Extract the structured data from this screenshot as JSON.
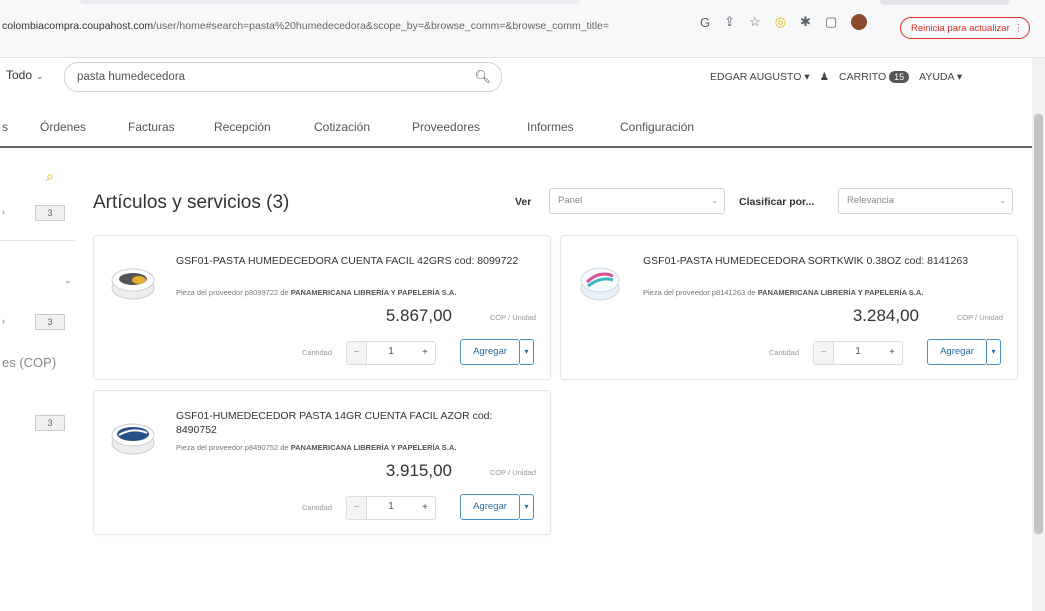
{
  "browser": {
    "url_host": "colombiacompra.coupahost.com",
    "url_rest": "/user/home#search=pasta%20humedecedora&scope_by=&browse_comm=&browse_comm_title=",
    "refresh_button": "Reinicia para actualizar",
    "icons": [
      "google-icon",
      "share-icon",
      "star-icon",
      "extension-icon",
      "puzzle-icon",
      "sidebar-icon",
      "profile-avatar",
      "kebab-menu-icon"
    ]
  },
  "header": {
    "scope": "Todo",
    "search_value": "pasta humedecedora",
    "user": "EDGAR AUGUSTO",
    "cart_label": "CARRITO",
    "cart_count": "15",
    "help_label": "AYUDA"
  },
  "nav": {
    "items": [
      "s",
      "Órdenes",
      "Facturas",
      "Recepción",
      "Cotización",
      "Proveedores",
      "Informes",
      "Configuración"
    ]
  },
  "sidebar": {
    "counts": [
      "3",
      "3",
      "3"
    ],
    "partial_label": "es (COP)"
  },
  "results": {
    "title": "Artículos y servicios (3)",
    "view_label": "Ver",
    "view_value": "Panel",
    "sort_label": "Clasificar por...",
    "sort_value": "Relevancia"
  },
  "products": [
    {
      "name": "GSF01-PASTA HUMEDECEDORA CUENTA FACIL 42GRS cod: 8099722",
      "supplier_prefix": "Pieza del proveedor p8099722 de",
      "supplier": "PANAMERICANA LIBRERÍA Y PAPELERÍA S.A.",
      "price": "5.867,00",
      "unit": "COP / Unidad",
      "qty_label": "Cantidad",
      "qty": "1",
      "add_label": "Agregar",
      "thumb_color": "#e0b030"
    },
    {
      "name": "GSF01-PASTA HUMEDECEDORA SORTKWIK 0.38OZ cod: 8141263",
      "supplier_prefix": "Pieza del proveedor p8141263 de",
      "supplier": "PANAMERICANA LIBRERÍA Y PAPELERÍA S.A.",
      "price": "3.284,00",
      "unit": "COP / Unidad",
      "qty_label": "Cantidad",
      "qty": "1",
      "add_label": "Agregar",
      "thumb_color": "#d94f9a"
    },
    {
      "name": "GSF01-HUMEDECEDOR PASTA 14GR CUENTA FACIL AZOR cod: 8490752",
      "supplier_prefix": "Pieza del proveedor p8490752 de",
      "supplier": "PANAMERICANA LIBRERÍA Y PAPELERÍA S.A.",
      "price": "3.915,00",
      "unit": "COP / Unidad",
      "qty_label": "Cantidad",
      "qty": "1",
      "add_label": "Agregar",
      "thumb_color": "#2a4f8a"
    }
  ],
  "colors": {
    "accent": "#2b6aa3",
    "alert": "#d93025"
  }
}
